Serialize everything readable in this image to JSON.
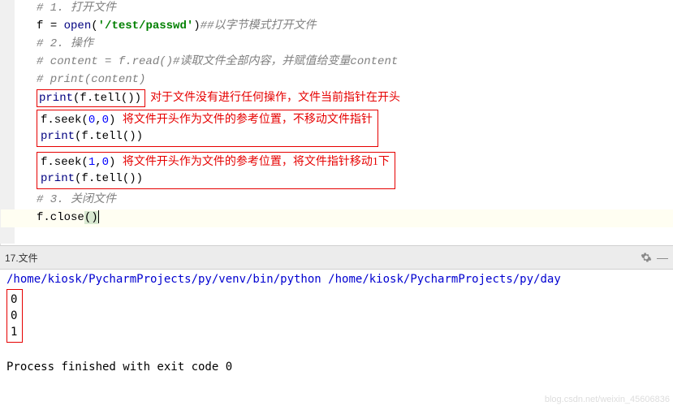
{
  "editor": {
    "lines": {
      "c1": "# 1. 打开文件",
      "c1_hash": "#",
      "c1_text": " 1. 打开文件",
      "l2_var": "f ",
      "l2_eq": "= ",
      "l2_open": "open",
      "l2_lp": "(",
      "l2_str": "'/test/passwd'",
      "l2_rp": ")",
      "l2_cmt": "##以字节模式打开文件",
      "c3_hash": "#",
      "c3_text": " 2. 操作",
      "c4_hash": "#",
      "c4_text": " content = f.read()#读取文件全部内容，并赋值给变量content",
      "c5_hash": "#",
      "c5_text": " print(content)",
      "l6_print": "print",
      "l6_lp": "(",
      "l6_f": "f.tell",
      "l6_lp2": "(",
      "l6_rp2": ")",
      "l6_rp": ")",
      "a6": "对于文件没有进行任何操作，文件当前指针在开头",
      "l7_f": "f.seek",
      "l7_lp": "(",
      "l7_n1": "0",
      "l7_comma": ",",
      "l7_n2": "0",
      "l7_rp": ")",
      "a7": "将文件开头作为文件的参考位置，不移动文件指针",
      "l8_print": "print",
      "l8_lp": "(",
      "l8_f": "f.tell",
      "l8_lp2": "(",
      "l8_rp2": ")",
      "l8_rp": ")",
      "l9_f": "f.seek",
      "l9_lp": "(",
      "l9_n1": "1",
      "l9_comma": ",",
      "l9_n2": "0",
      "l9_rp": ")",
      "a9": "将文件开头作为文件的参考位置，将文件指针移动1下",
      "l10_print": "print",
      "l10_lp": "(",
      "l10_f": "f.tell",
      "l10_lp2": "(",
      "l10_rp2": ")",
      "l10_rp": ")",
      "c11_hash": "#",
      "c11_text": " 3. 关闭文件",
      "l12_f": "f.close",
      "l12_lp": "(",
      "l12_rp": ")"
    }
  },
  "console": {
    "tab": "17.文件",
    "cmd_part1": "/home/kiosk/PycharmProjects/py/venv/bin/python",
    "cmd_sep": " ",
    "cmd_part2": "/home/kiosk/PycharmProjects/py/day",
    "out1": "0",
    "out2": "0",
    "out3": "1",
    "exit_msg": "Process finished with exit code 0"
  },
  "watermark": "blog.csdn.net/weixin_45606836"
}
